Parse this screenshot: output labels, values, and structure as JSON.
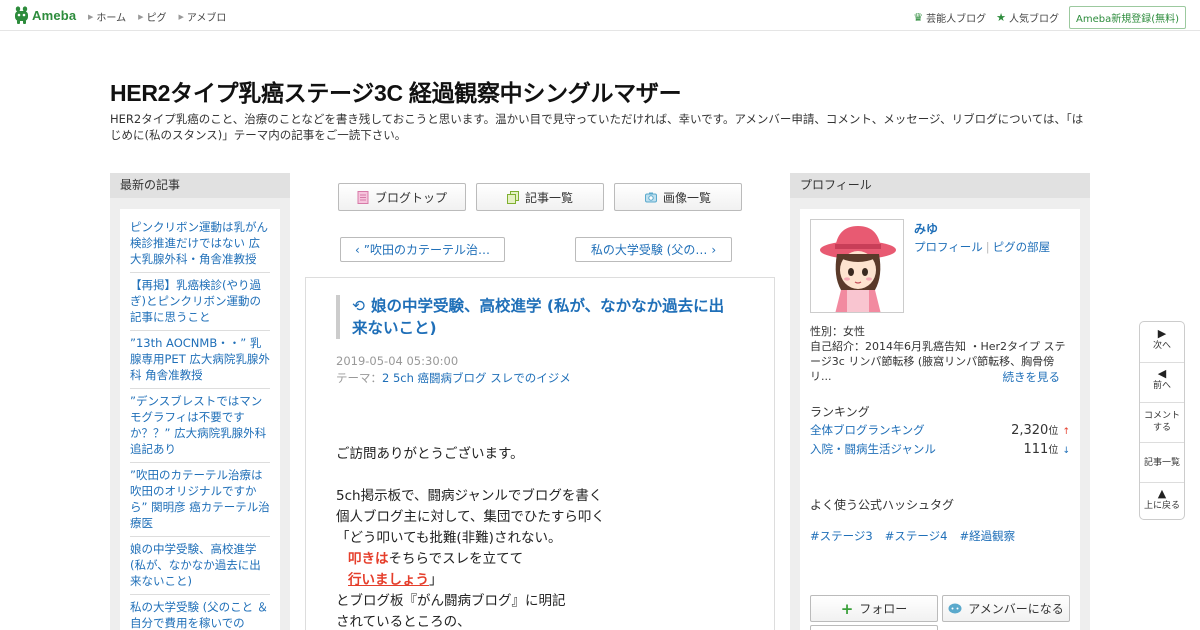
{
  "topbar": {
    "logo_text": "Ameba",
    "nav": [
      "ホーム",
      "ピグ",
      "アメブロ"
    ],
    "right_links": [
      "芸能人ブログ",
      "人気ブログ"
    ],
    "signup": "Ameba新規登録(無料)"
  },
  "blog": {
    "title": "HER2タイプ乳癌ステージ3C 経過観察中シングルマザー",
    "description": "HER2タイプ乳癌のこと、治療のことなどを書き残しておこうと思います。温かい目で見守っていただければ、幸いです。アメンバー申請、コメント、メッセージ、リブログについては、「はじめに(私のスタンス)」テーマ内の記事をご一読下さい。"
  },
  "left_sidebar": {
    "heading": "最新の記事",
    "items": [
      "ピンクリボン運動は乳がん検診推進だけではない 広大乳腺外科・角舎准教授",
      "【再掲】乳癌検診(やり過ぎ)とピンクリボン運動の記事に思うこと",
      "”13th AOCNMB・・” 乳腺専用PET 広大病院乳腺外科 角舎准教授",
      "”デンスブレストではマンモグラフィは不要ですか？？” 広大病院乳腺外科 追記あり",
      "”吹田のカテーテル治療は吹田のオリジナルですから” 関明彦 癌カテーテル治療医",
      "娘の中学受験、高校進学 (私が、なかなか過去に出来ないこと)",
      "私の大学受験 (父のこと ＆ 自分で費用を稼いでの"
    ]
  },
  "center": {
    "buttons": [
      "ブログトップ",
      "記事一覧",
      "画像一覧"
    ],
    "prev": "”吹田のカテーテル治…",
    "next": "私の大学受験 (父の…",
    "article": {
      "title": "娘の中学受験、高校進学 (私が、なかなか過去に出来ないこと)",
      "date": "2019-05-04 05:30:00",
      "theme_label": "テーマ：",
      "theme": "2 5ch 癌闘病ブログ スレでのイジメ",
      "lines": {
        "l1": "ご訪問ありがとうございます。",
        "l2": "5ch掲示板で、闘病ジャンルでブログを書く",
        "l3": "個人ブログ主に対して、集団でひたすら叩く",
        "l4": "「どう叩いても批難(非難)されない。",
        "l5_red": "叩きは",
        "l5_rest": "そちらでスレを立てて",
        "l6_red": "行いましょう",
        "l6_rest": "」",
        "l7": "とブログ板『がん闘病ブログ』に明記",
        "l8": "されているところの、"
      }
    }
  },
  "right_sidebar": {
    "heading": "プロフィール",
    "name": "みゆ",
    "link_profile": "プロフィール",
    "link_room": "ピグの部屋",
    "gender": "性別：女性",
    "intro": "自己紹介：2014年6月乳癌告知 ・Her2タイプ ステージ3c リンパ節転移 (腋窩リンパ節転移、胸骨傍リ...",
    "more": "続きを見る",
    "ranking_heading": "ランキング",
    "rankings": [
      {
        "name": "全体ブログランキング",
        "value": "2,320",
        "unit": "位",
        "trend": "↑"
      },
      {
        "name": "入院・闘病生活ジャンル",
        "value": "111",
        "unit": "位",
        "trend": "↓"
      }
    ],
    "hashtag_heading": "よく使う公式ハッシュタグ",
    "hashtags": [
      "#ステージ3",
      "#ステージ4",
      "#経過観察"
    ],
    "follow": "フォロー",
    "amember": "アメンバーになる"
  },
  "floatnav": {
    "next": "次へ",
    "prev": "前へ",
    "comment": "コメントする",
    "list": "記事一覧",
    "top": "上に戻る"
  },
  "colors": {
    "brand_green": "#2d8c3c",
    "link_blue": "#1f6fb8",
    "emphasis_red": "#e53e2b"
  }
}
